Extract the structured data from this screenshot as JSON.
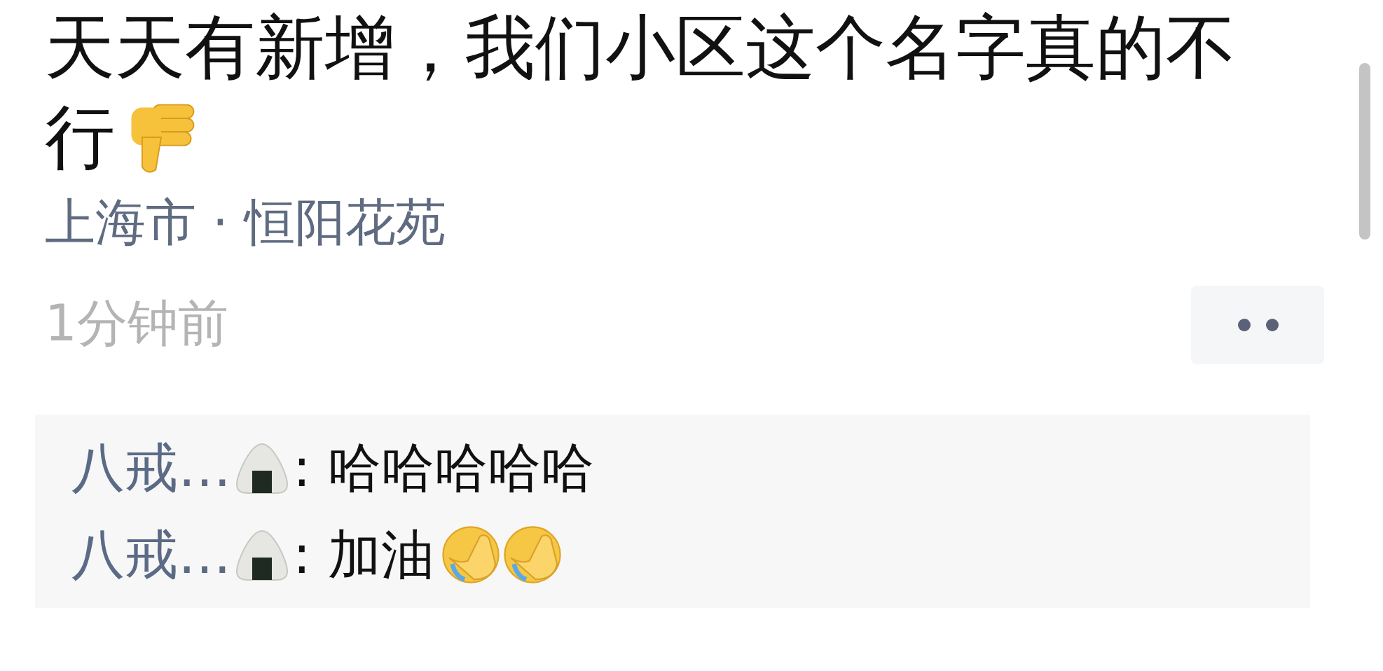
{
  "post": {
    "text_lines": [
      "天天有新增，我们小区这个名字真的不",
      "行"
    ],
    "location": "上海市 · 恒阳花苑",
    "time": "1分钟前"
  },
  "comments": [
    {
      "author": "八戒…",
      "text": ": 哈哈哈哈哈",
      "kind": "plain"
    },
    {
      "author": "八戒…",
      "text": ": 加油",
      "kind": "facepalm"
    }
  ]
}
